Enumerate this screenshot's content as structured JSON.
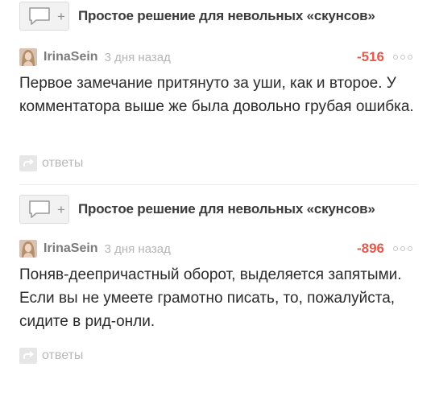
{
  "comments": [
    {
      "post_title": "Простое решение для невольных «скунсов»",
      "username": "IrinaSein",
      "time": "3 дня назад",
      "rating": "-516",
      "text": "Первое замечание притянуто за уши, как и второе. У комментатора выше же была довольно грубая ошибка.",
      "reply_label": "ответы"
    },
    {
      "post_title": "Простое решение для невольных «скунсов»",
      "username": "IrinaSein",
      "time": "3 дня назад",
      "rating": "-896",
      "text": "Поняв-деепричастный оборот, выделяется запятыми. Если вы не умеете грамотно писать, то, пожалуйста, сидите в рид-онли.",
      "reply_label": "ответы"
    }
  ],
  "icons": {
    "post": "comment-bubble-icon",
    "plus": "plus-icon",
    "more": "more-dots-icon",
    "reply": "reply-arrow-icon"
  },
  "colors": {
    "rating": "#e05a4e",
    "username": "#7b7b7b",
    "muted": "#b5b5b5"
  }
}
